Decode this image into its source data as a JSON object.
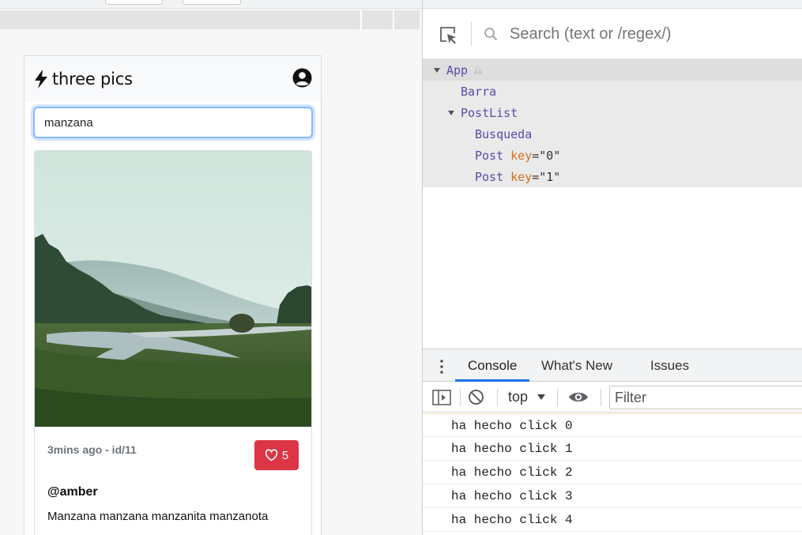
{
  "app": {
    "brand": "three pics",
    "search_value": "manzana",
    "post": {
      "meta": "3mins ago - id/11",
      "likes": "5",
      "user": "@amber",
      "text": "Manzana manzana manzanita manzanota"
    }
  },
  "devtools": {
    "search_placeholder": "Search (text or /regex/)",
    "tree": [
      {
        "name": "App"
      },
      {
        "name": "Barra"
      },
      {
        "name": "PostList"
      },
      {
        "name": "Busqueda"
      },
      {
        "name": "Post",
        "key_attr": "key",
        "key_value": "\"0\""
      },
      {
        "name": "Post",
        "key_attr": "key",
        "key_value": "\"1\""
      }
    ],
    "drawer_tabs": [
      "Console",
      "What's New",
      "Issues"
    ],
    "context": "top",
    "filter_placeholder": "Filter",
    "logs": [
      "ha hecho click 0",
      "ha hecho click 1",
      "ha hecho click 2",
      "ha hecho click 3",
      "ha hecho click 4"
    ]
  },
  "colors": {
    "like_button": "#dc3545",
    "component_name": "#5c4aa8",
    "key_attr": "#d5701d",
    "active_tab_underline": "#1a73e8"
  }
}
